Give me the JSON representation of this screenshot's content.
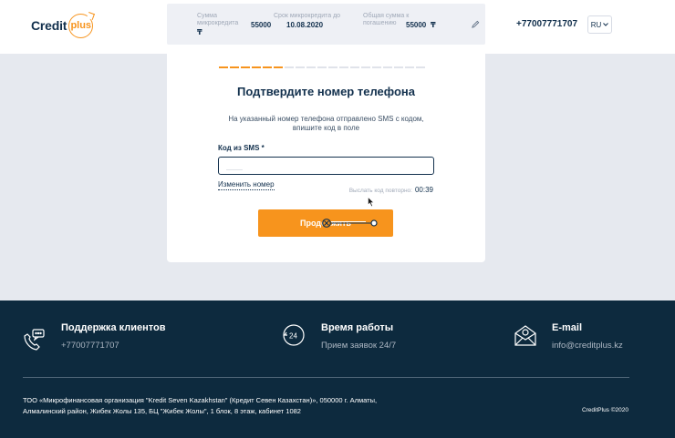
{
  "header": {
    "logo_text": "Credit",
    "logo_ring_text": "plus",
    "summary": {
      "loan_amount_label": "Сумма микрокредита",
      "loan_amount_value": "55000",
      "loan_amount_currency": "₸",
      "term_label": "Срок микрокредита до",
      "term_value": "10.08.2020",
      "total_label": "Общая сумма к погашению",
      "total_value": "55000",
      "total_currency": "₸"
    },
    "phone": "+77007771707",
    "language": "RU"
  },
  "verify": {
    "title": "Подтвердите номер телефона",
    "description": "На указанный номер телефона отправлено SMS с кодом, впишите код в поле",
    "field_label": "Код из SMS *",
    "field_placeholder": "____",
    "change_number": "Изменить номер",
    "resend_label": "Выслать код повторно:",
    "resend_timer": "00:39",
    "submit_label": "Продолжить",
    "progress": {
      "filled": 6,
      "total": 19
    }
  },
  "footer": {
    "support": {
      "title": "Поддержка клиентов",
      "value": "+77007771707",
      "icon": "phone-chat-icon"
    },
    "hours": {
      "title": "Время работы",
      "value": "Прием заявок 24/7",
      "icon": "clock-24-icon"
    },
    "email": {
      "title": "E-mail",
      "value": "info@creditplus.kz",
      "icon": "envelope-icon"
    },
    "legal": "ТОО «Микрофинансовая организация \"Kredit Seven Kazakhstan\" (Кредит Севен Казахстан)», 050000 г. Алматы, Алмалинский район, Жибек Жолы 135, БЦ \"Жибек Жолы\", 1 блок, 8 этаж, кабинет 1082",
    "copyright": "CreditPlus ©2020"
  },
  "colors": {
    "accent": "#f7941d",
    "dark": "#0d2a3e",
    "text": "#12304d"
  }
}
